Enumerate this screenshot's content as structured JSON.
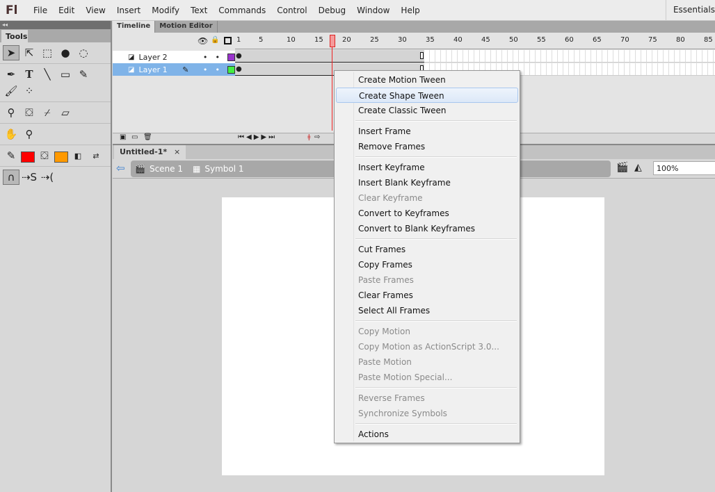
{
  "app": {
    "logo": "Fl",
    "workspace": "Essentials"
  },
  "menubar": [
    "File",
    "Edit",
    "View",
    "Insert",
    "Modify",
    "Text",
    "Commands",
    "Control",
    "Debug",
    "Window",
    "Help"
  ],
  "tools": {
    "panel_title": "Tools",
    "collapse": "◂◂",
    "stroke_color": "#ff0000",
    "fill_color": "#ff9900"
  },
  "timeline": {
    "tabs": [
      "Timeline",
      "Motion Editor"
    ],
    "layers": [
      {
        "name": "Layer 2",
        "color": "#9933cc"
      },
      {
        "name": "Layer 1",
        "color": "#44ee44",
        "selected": true
      }
    ],
    "ruler_labels": [
      "1",
      "5",
      "10",
      "15",
      "20",
      "25",
      "30",
      "35",
      "40",
      "45",
      "50",
      "55",
      "60",
      "65",
      "70",
      "75",
      "80",
      "85"
    ],
    "playhead_frame": 18,
    "last_frame": 34
  },
  "document": {
    "tab": "Untitled-1*",
    "close": "×",
    "scene": "Scene 1",
    "symbol": "Symbol 1",
    "zoom": "100%"
  },
  "context_menu": [
    [
      {
        "label": "Create Motion Tween"
      },
      {
        "label": "Create Shape Tween",
        "highlighted": true
      },
      {
        "label": "Create Classic Tween"
      }
    ],
    [
      {
        "label": "Insert Frame"
      },
      {
        "label": "Remove Frames"
      }
    ],
    [
      {
        "label": "Insert Keyframe"
      },
      {
        "label": "Insert Blank Keyframe"
      },
      {
        "label": "Clear Keyframe",
        "disabled": true
      },
      {
        "label": "Convert to Keyframes"
      },
      {
        "label": "Convert to Blank Keyframes"
      }
    ],
    [
      {
        "label": "Cut Frames"
      },
      {
        "label": "Copy Frames"
      },
      {
        "label": "Paste Frames",
        "disabled": true
      },
      {
        "label": "Clear Frames"
      },
      {
        "label": "Select All Frames"
      }
    ],
    [
      {
        "label": "Copy Motion",
        "disabled": true
      },
      {
        "label": "Copy Motion as ActionScript 3.0...",
        "disabled": true
      },
      {
        "label": "Paste Motion",
        "disabled": true
      },
      {
        "label": "Paste Motion Special...",
        "disabled": true
      }
    ],
    [
      {
        "label": "Reverse Frames",
        "disabled": true
      },
      {
        "label": "Synchronize Symbols",
        "disabled": true
      }
    ],
    [
      {
        "label": "Actions"
      }
    ]
  ]
}
